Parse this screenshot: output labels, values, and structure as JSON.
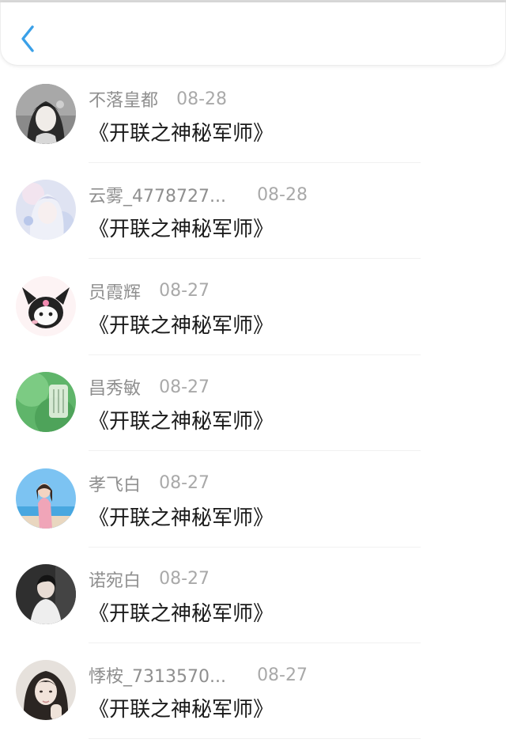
{
  "header": {
    "back_icon": "chevron-left-icon",
    "accent": "#3aa0e8"
  },
  "comments": [
    {
      "name": "不落皇都",
      "date": "08-28",
      "text": "《开联之神秘军师》",
      "avatar": "anime-girl-avatar"
    },
    {
      "name": "云雾_4778727...",
      "date": "08-28",
      "text": "《开联之神秘军师》",
      "avatar": "pastel-anime-avatar"
    },
    {
      "name": "员霞辉",
      "date": "08-27",
      "text": "《开联之神秘军师》",
      "avatar": "kuromi-avatar"
    },
    {
      "name": "昌秀敏",
      "date": "08-27",
      "text": "《开联之神秘军师》",
      "avatar": "green-jade-avatar"
    },
    {
      "name": "孝飞白",
      "date": "08-27",
      "text": "《开联之神秘军师》",
      "avatar": "beach-girl-avatar"
    },
    {
      "name": "诺宛白",
      "date": "08-27",
      "text": "《开联之神秘军师》",
      "avatar": "dark-portrait-avatar"
    },
    {
      "name": "悸桉_7313570...",
      "date": "08-27",
      "text": "《开联之神秘军师》",
      "avatar": "girl-portrait-avatar"
    }
  ]
}
